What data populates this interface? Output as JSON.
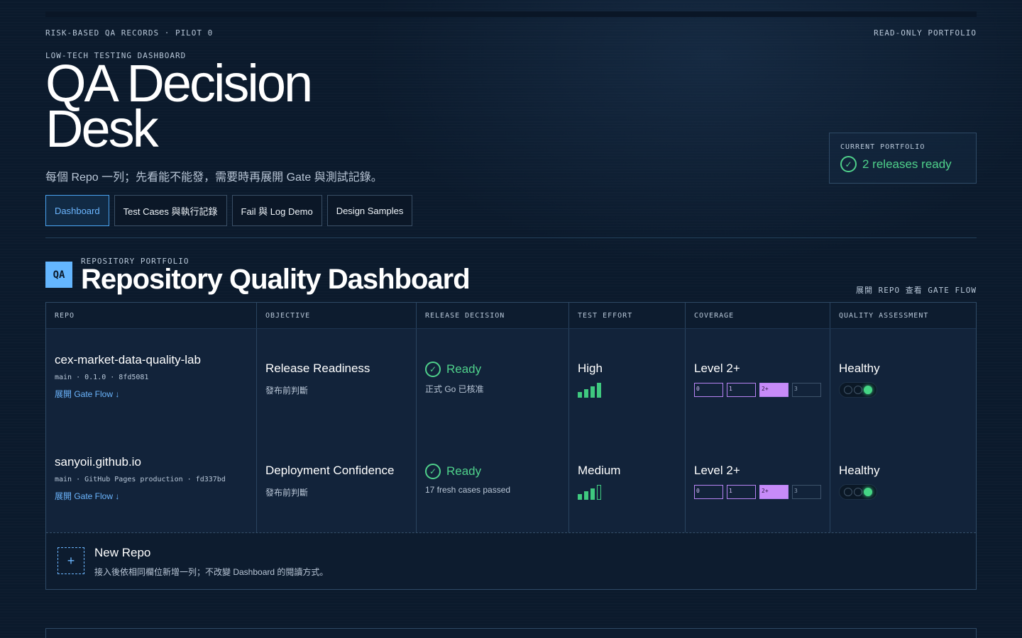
{
  "header": {
    "eyebrow_left": "RISK-BASED QA RECORDS · PILOT 0",
    "eyebrow_right": "READ-ONLY PORTFOLIO",
    "kicker": "LOW-TECH TESTING DASHBOARD",
    "title": "QA Decision Desk",
    "subtitle": "每個 Repo 一列；先看能不能發，需要時再展開 Gate 與測試記錄。"
  },
  "status_card": {
    "label": "CURRENT PORTFOLIO",
    "value": "2 releases ready",
    "icon": "check-circle-icon",
    "color": "#4fd18b"
  },
  "tabs": [
    {
      "label": "Dashboard",
      "active": true
    },
    {
      "label": "Test Cases 與執行記錄",
      "active": false
    },
    {
      "label": "Fail 與 Log Demo",
      "active": false
    },
    {
      "label": "Design Samples",
      "active": false
    }
  ],
  "section": {
    "badge": "QA",
    "eyebrow": "REPOSITORY PORTFOLIO",
    "title": "Repository Quality Dashboard",
    "hint": "展開 REPO 查看 GATE FLOW"
  },
  "table": {
    "columns": [
      "REPO",
      "OBJECTIVE",
      "RELEASE DECISION",
      "TEST EFFORT",
      "COVERAGE",
      "QUALITY ASSESSMENT"
    ],
    "rows": [
      {
        "repo_name": "cex-market-data-quality-lab",
        "repo_meta": "main · 0.1.0 · 8fd5081",
        "repo_link": "展開 Gate Flow ↓",
        "objective": "Release Readiness",
        "objective_sub": "發布前判斷",
        "decision": "Ready",
        "decision_sub": "正式 Go 已核准",
        "effort": "High",
        "effort_level": 4,
        "coverage": "Level 2+",
        "coverage_levels": [
          "0",
          "1",
          "2+",
          "3"
        ],
        "coverage_active": 2,
        "assessment": "Healthy",
        "lights_on": 3
      },
      {
        "repo_name": "sanyoii.github.io",
        "repo_meta": "main · GitHub Pages production · fd337bd",
        "repo_link": "展開 Gate Flow ↓",
        "objective": "Deployment Confidence",
        "objective_sub": "發布前判斷",
        "decision": "Ready",
        "decision_sub": "17 fresh cases passed",
        "effort": "Medium",
        "effort_level": 3,
        "coverage": "Level 2+",
        "coverage_levels": [
          "0",
          "1",
          "2+",
          "3"
        ],
        "coverage_active": 2,
        "assessment": "Healthy",
        "lights_on": 3
      }
    ]
  },
  "new_repo": {
    "icon": "+",
    "title": "New Repo",
    "description": "接入後依相同欄位新增一列；不改變 Dashboard 的閱讀方式。"
  }
}
